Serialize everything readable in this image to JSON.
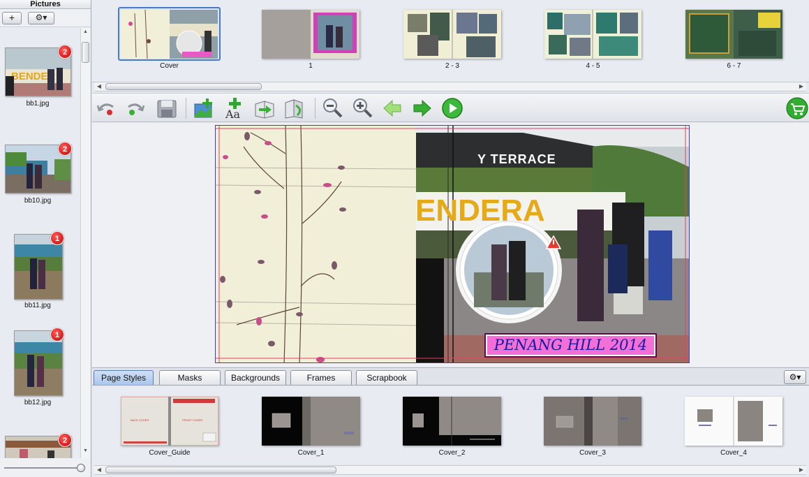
{
  "left_panel": {
    "title": "Pictures",
    "add_label": "+",
    "gear_label": "⚙▾",
    "pictures": [
      {
        "name": "bb1.jpg",
        "count": "2"
      },
      {
        "name": "bb10.jpg",
        "count": "2"
      },
      {
        "name": "bb11.jpg",
        "count": "1"
      },
      {
        "name": "bb12.jpg",
        "count": "1"
      },
      {
        "name": "",
        "count": "2"
      }
    ]
  },
  "pages": [
    {
      "label": "Cover"
    },
    {
      "label": "1"
    },
    {
      "label": "2 - 3"
    },
    {
      "label": "4 - 5"
    },
    {
      "label": "6 - 7"
    }
  ],
  "toolbar": {
    "undo": "undo-icon",
    "redo": "redo-icon",
    "save": "save-icon",
    "add_picture": "add-picture-icon",
    "add_text": "add-text-icon",
    "insert_page": "insert-page-icon",
    "move_page": "move-page-icon",
    "zoom_out": "zoom-out-icon",
    "zoom_in": "zoom-in-icon",
    "prev": "arrow-left-icon",
    "next": "arrow-right-icon",
    "play": "play-icon",
    "cart": "cart-icon"
  },
  "canvas": {
    "sign_lines": [
      "Y TERRACE",
      "ENDERA"
    ],
    "caption": "PENANG HILL 2014"
  },
  "tabs": [
    "Page Styles",
    "Masks",
    "Backgrounds",
    "Frames",
    "Scrapbook"
  ],
  "tabs_gear": "⚙▾",
  "styles": [
    {
      "label": "Cover_Guide",
      "inner_left": "BACK COVER",
      "inner_right": "FRONT COVER"
    },
    {
      "label": "Cover_1"
    },
    {
      "label": "Cover_2"
    },
    {
      "label": "Cover_3"
    },
    {
      "label": "Cover_4"
    }
  ],
  "colors": {
    "badge": "#d40000",
    "selection": "#4a79c6",
    "caption_bg": "#f26fd6",
    "caption_text": "#1a1aa0",
    "go_green": "#2fa82f"
  }
}
